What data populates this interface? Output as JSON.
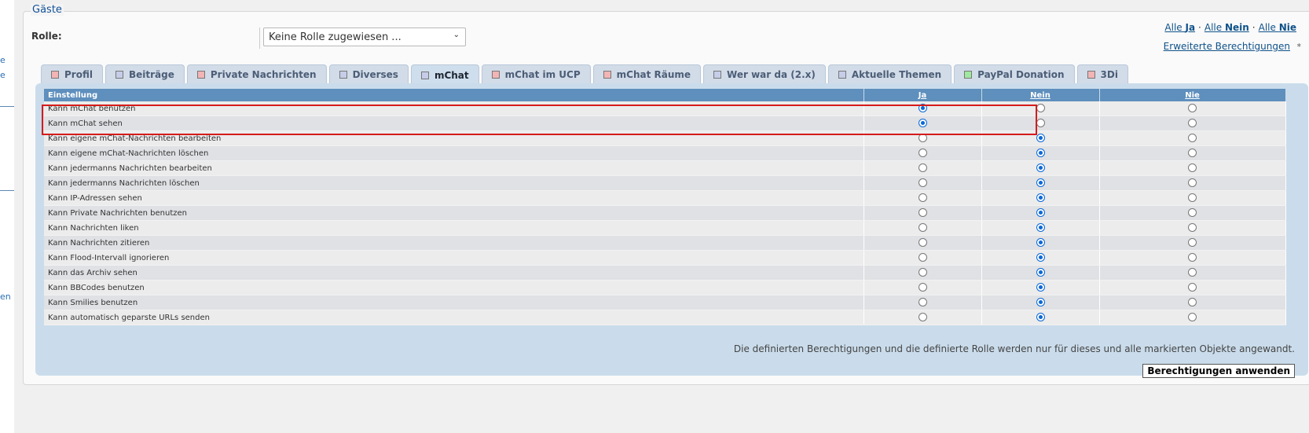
{
  "left_edge": {
    "fragments": [
      "e",
      "e",
      "en"
    ]
  },
  "fieldset": {
    "legend": "Gäste"
  },
  "role": {
    "label": "Rolle:",
    "selected": "Keine Rolle zugewiesen ..."
  },
  "quick_links": {
    "all_yes_prefix": "Alle ",
    "all_yes": "Ja",
    "all_no_prefix": "Alle ",
    "all_no": "Nein",
    "all_never_prefix": "Alle ",
    "all_never": "Nie",
    "separator": "·"
  },
  "advanced": {
    "label": "Erweiterte Berechtigungen",
    "marker": "*"
  },
  "tabs": [
    {
      "label": "Profil",
      "color": "#f2b4b4",
      "active": false
    },
    {
      "label": "Beiträge",
      "color": "#c6cde8",
      "active": false
    },
    {
      "label": "Private Nachrichten",
      "color": "#f2b4b4",
      "active": false
    },
    {
      "label": "Diverses",
      "color": "#c6cde8",
      "active": false
    },
    {
      "label": "mChat",
      "color": "#c6cde8",
      "active": true
    },
    {
      "label": "mChat im UCP",
      "color": "#f2b4b4",
      "active": false
    },
    {
      "label": "mChat Räume",
      "color": "#f2b4b4",
      "active": false
    },
    {
      "label": "Wer war da (2.x)",
      "color": "#c6cde8",
      "active": false
    },
    {
      "label": "Aktuelle Themen",
      "color": "#c6cde8",
      "active": false
    },
    {
      "label": "PayPal Donation",
      "color": "#9fe89f",
      "active": false
    },
    {
      "label": "3Di",
      "color": "#f2b4b4",
      "active": false
    }
  ],
  "table": {
    "headers": {
      "setting": "Einstellung",
      "yes": "Ja",
      "no": "Nein",
      "never": "Nie"
    },
    "rows": [
      {
        "label": "Kann mChat benutzen",
        "value": "yes"
      },
      {
        "label": "Kann mChat sehen",
        "value": "yes"
      },
      {
        "label": "Kann eigene mChat-Nachrichten bearbeiten",
        "value": "no"
      },
      {
        "label": "Kann eigene mChat-Nachrichten löschen",
        "value": "no"
      },
      {
        "label": "Kann jedermanns Nachrichten bearbeiten",
        "value": "no"
      },
      {
        "label": "Kann jedermanns Nachrichten löschen",
        "value": "no"
      },
      {
        "label": "Kann IP-Adressen sehen",
        "value": "no"
      },
      {
        "label": "Kann Private Nachrichten benutzen",
        "value": "no"
      },
      {
        "label": "Kann Nachrichten liken",
        "value": "no"
      },
      {
        "label": "Kann Nachrichten zitieren",
        "value": "no"
      },
      {
        "label": "Kann Flood-Intervall ignorieren",
        "value": "no"
      },
      {
        "label": "Kann das Archiv sehen",
        "value": "no"
      },
      {
        "label": "Kann BBCodes benutzen",
        "value": "no"
      },
      {
        "label": "Kann Smilies benutzen",
        "value": "no"
      },
      {
        "label": "Kann automatisch geparste URLs senden",
        "value": "no"
      }
    ]
  },
  "footer": {
    "note": "Die definierten Berechtigungen und die definierte Rolle werden nur für dieses und alle markierten Objekte angewandt.",
    "apply_button": "Berechtigungen anwenden"
  },
  "colors": {
    "highlight": "#d61b1b",
    "header": "#5e8fbd",
    "accent": "#0a68d8"
  }
}
